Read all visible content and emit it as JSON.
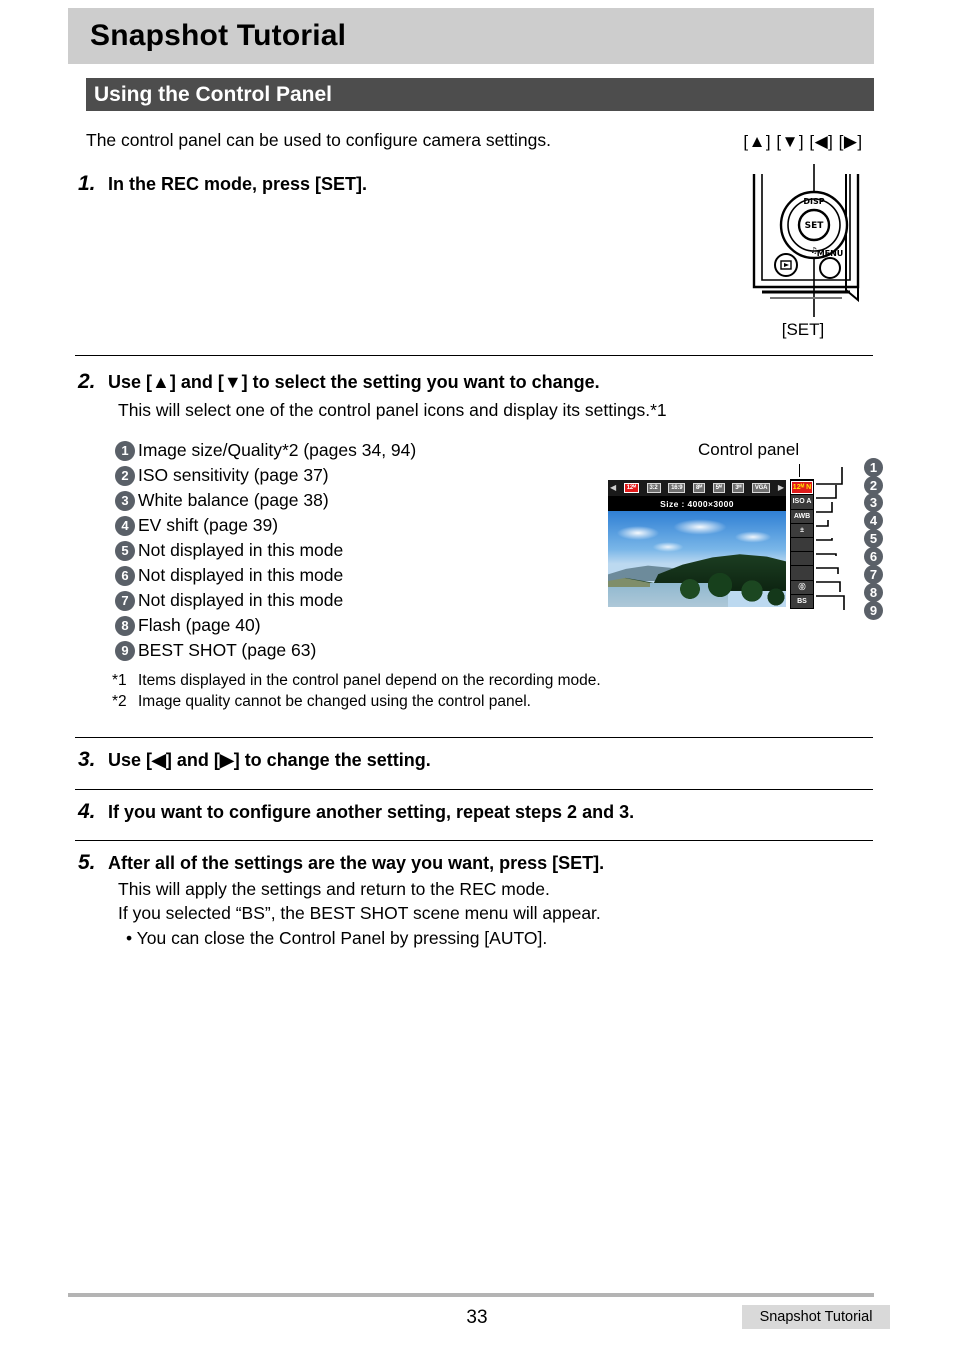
{
  "page": {
    "title": "Snapshot Tutorial",
    "section": "Using the Control Panel",
    "intro": "The control panel can be used to configure camera settings.",
    "number": "33",
    "footer_tab": "Snapshot Tutorial"
  },
  "steps": [
    {
      "num": "1.",
      "head": "In the REC mode, press [SET].",
      "sub": []
    },
    {
      "num": "2.",
      "head": "Use [▲] and [▼] to select the setting you want to change.",
      "sub": [
        "This will select one of the control panel icons and display its settings.*1"
      ]
    },
    {
      "num": "3.",
      "head": "Use [◀] and [▶] to change the setting.",
      "sub": []
    },
    {
      "num": "4.",
      "head": "If you want to configure another setting, repeat steps 2 and 3.",
      "sub": []
    },
    {
      "num": "5.",
      "head": "After all of the settings are the way you want, press [SET].",
      "sub": [
        "This will apply the settings and return to the REC mode.",
        "If you selected “BS”, the BEST SHOT scene menu will appear.",
        "• You can close the Control Panel by pressing [AUTO]."
      ]
    }
  ],
  "features": [
    {
      "n": "1",
      "text": "Image size/Quality*2 (pages 34, 94)"
    },
    {
      "n": "2",
      "text": "ISO sensitivity (page 37)"
    },
    {
      "n": "3",
      "text": "White balance (page 38)"
    },
    {
      "n": "4",
      "text": "EV shift (page 39)"
    },
    {
      "n": "5",
      "text": "Not displayed in this mode"
    },
    {
      "n": "6",
      "text": "Not displayed in this mode"
    },
    {
      "n": "7",
      "text": "Not displayed in this mode"
    },
    {
      "n": "8",
      "text": "Flash (page 40)"
    },
    {
      "n": "9",
      "text": "BEST SHOT (page 63)"
    }
  ],
  "footnotes": [
    {
      "mark": "*1",
      "text": "Items displayed in the control panel depend on the recording mode."
    },
    {
      "mark": "*2",
      "text": "Image quality cannot be changed using the control panel."
    }
  ],
  "camera_diagram": {
    "key_label": "[▲] [▼] [◀] [▶]",
    "set_label": "[SET]",
    "disp_label": "DISP",
    "set_button_label": "SET",
    "menu_label": "MENU",
    "playback_icon": "playback-icon"
  },
  "control_panel": {
    "caption": "Control panel",
    "size_line": "Size : 4000×3000",
    "left_arrow": "◀",
    "right_arrow": "▶",
    "size_chips": [
      {
        "label": "12ᴹ",
        "selected": true
      },
      {
        "label": "3:2",
        "selected": false
      },
      {
        "label": "16:9",
        "selected": false
      },
      {
        "label": "8ᴹ",
        "selected": false
      },
      {
        "label": "5ᴹ",
        "selected": false
      },
      {
        "label": "3ᴹ",
        "selected": false
      },
      {
        "label": "VGA",
        "selected": false
      }
    ],
    "icons": [
      {
        "label": "12ᴹ N",
        "kind": "red",
        "name": "image-size-icon"
      },
      {
        "label": "ISO A",
        "kind": "dark",
        "name": "iso-sensitivity-icon"
      },
      {
        "label": "AWB",
        "kind": "dark",
        "name": "white-balance-icon"
      },
      {
        "label": "±",
        "kind": "dark",
        "name": "ev-shift-icon"
      },
      {
        "label": "",
        "kind": "blank",
        "name": "not-displayed-icon-5"
      },
      {
        "label": "",
        "kind": "blank",
        "name": "not-displayed-icon-6"
      },
      {
        "label": "",
        "kind": "blank",
        "name": "not-displayed-icon-7"
      },
      {
        "label": "⓪",
        "kind": "dark",
        "name": "flash-icon"
      },
      {
        "label": "BS",
        "kind": "dark",
        "name": "best-shot-icon"
      }
    ],
    "callouts": [
      "1",
      "2",
      "3",
      "4",
      "5",
      "6",
      "7",
      "8",
      "9"
    ]
  }
}
